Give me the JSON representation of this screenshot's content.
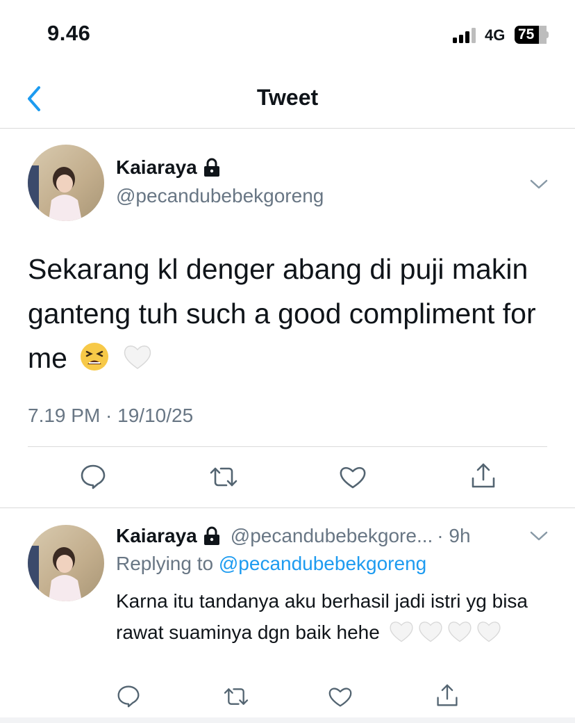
{
  "status_bar": {
    "time": "9.46",
    "network": "4G",
    "battery_level": "75"
  },
  "nav": {
    "title": "Tweet"
  },
  "main_tweet": {
    "display_name": "Kaiaraya",
    "handle": "@pecandubebekgoreng",
    "text": "Sekarang kl denger abang di puji makin ganteng tuh such a good compliment for me",
    "emojis": [
      "tired-face-emoji",
      "white-heart-emoji"
    ],
    "timestamp": "7.19 PM · 19/10/25"
  },
  "reply_tweet": {
    "display_name": "Kaiaraya",
    "handle": "@pecandubebekgore...",
    "time": "· 9h",
    "replying_prefix": "Replying to",
    "replying_to": "@pecandubebekgoreng",
    "text": "Karna itu tandanya aku berhasil jadi istri yg bisa rawat suaminya dgn baik hehe",
    "emojis": [
      "white-heart-emoji",
      "white-heart-emoji",
      "white-heart-emoji",
      "white-heart-emoji"
    ]
  },
  "actions": [
    "reply-icon",
    "retweet-icon",
    "like-icon",
    "share-icon"
  ],
  "colors": {
    "accent": "#1d9bf0",
    "text_primary": "#0f1419",
    "text_secondary": "#687684",
    "divider": "#dadada",
    "icon": "#536471"
  }
}
